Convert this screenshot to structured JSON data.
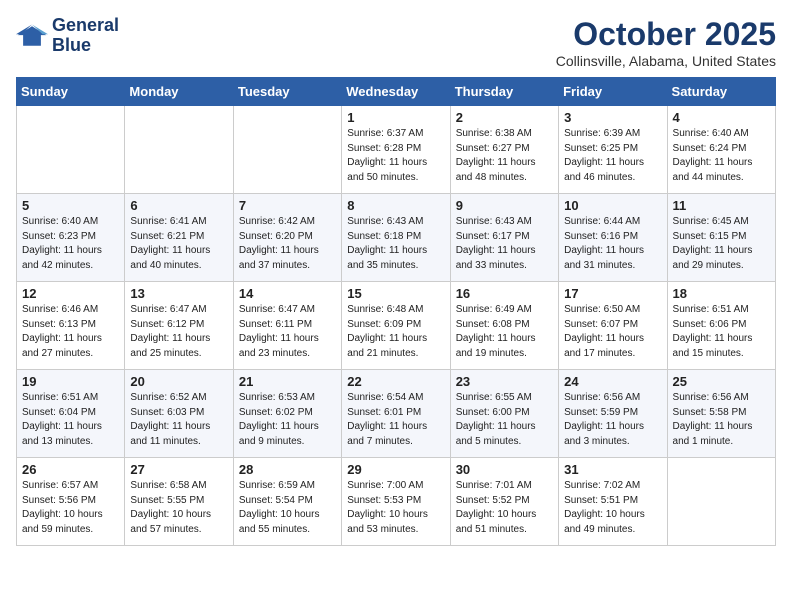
{
  "header": {
    "logo_line1": "General",
    "logo_line2": "Blue",
    "month": "October 2025",
    "location": "Collinsville, Alabama, United States"
  },
  "weekdays": [
    "Sunday",
    "Monday",
    "Tuesday",
    "Wednesday",
    "Thursday",
    "Friday",
    "Saturday"
  ],
  "weeks": [
    [
      {
        "day": "",
        "info": ""
      },
      {
        "day": "",
        "info": ""
      },
      {
        "day": "",
        "info": ""
      },
      {
        "day": "1",
        "info": "Sunrise: 6:37 AM\nSunset: 6:28 PM\nDaylight: 11 hours\nand 50 minutes."
      },
      {
        "day": "2",
        "info": "Sunrise: 6:38 AM\nSunset: 6:27 PM\nDaylight: 11 hours\nand 48 minutes."
      },
      {
        "day": "3",
        "info": "Sunrise: 6:39 AM\nSunset: 6:25 PM\nDaylight: 11 hours\nand 46 minutes."
      },
      {
        "day": "4",
        "info": "Sunrise: 6:40 AM\nSunset: 6:24 PM\nDaylight: 11 hours\nand 44 minutes."
      }
    ],
    [
      {
        "day": "5",
        "info": "Sunrise: 6:40 AM\nSunset: 6:23 PM\nDaylight: 11 hours\nand 42 minutes."
      },
      {
        "day": "6",
        "info": "Sunrise: 6:41 AM\nSunset: 6:21 PM\nDaylight: 11 hours\nand 40 minutes."
      },
      {
        "day": "7",
        "info": "Sunrise: 6:42 AM\nSunset: 6:20 PM\nDaylight: 11 hours\nand 37 minutes."
      },
      {
        "day": "8",
        "info": "Sunrise: 6:43 AM\nSunset: 6:18 PM\nDaylight: 11 hours\nand 35 minutes."
      },
      {
        "day": "9",
        "info": "Sunrise: 6:43 AM\nSunset: 6:17 PM\nDaylight: 11 hours\nand 33 minutes."
      },
      {
        "day": "10",
        "info": "Sunrise: 6:44 AM\nSunset: 6:16 PM\nDaylight: 11 hours\nand 31 minutes."
      },
      {
        "day": "11",
        "info": "Sunrise: 6:45 AM\nSunset: 6:15 PM\nDaylight: 11 hours\nand 29 minutes."
      }
    ],
    [
      {
        "day": "12",
        "info": "Sunrise: 6:46 AM\nSunset: 6:13 PM\nDaylight: 11 hours\nand 27 minutes."
      },
      {
        "day": "13",
        "info": "Sunrise: 6:47 AM\nSunset: 6:12 PM\nDaylight: 11 hours\nand 25 minutes."
      },
      {
        "day": "14",
        "info": "Sunrise: 6:47 AM\nSunset: 6:11 PM\nDaylight: 11 hours\nand 23 minutes."
      },
      {
        "day": "15",
        "info": "Sunrise: 6:48 AM\nSunset: 6:09 PM\nDaylight: 11 hours\nand 21 minutes."
      },
      {
        "day": "16",
        "info": "Sunrise: 6:49 AM\nSunset: 6:08 PM\nDaylight: 11 hours\nand 19 minutes."
      },
      {
        "day": "17",
        "info": "Sunrise: 6:50 AM\nSunset: 6:07 PM\nDaylight: 11 hours\nand 17 minutes."
      },
      {
        "day": "18",
        "info": "Sunrise: 6:51 AM\nSunset: 6:06 PM\nDaylight: 11 hours\nand 15 minutes."
      }
    ],
    [
      {
        "day": "19",
        "info": "Sunrise: 6:51 AM\nSunset: 6:04 PM\nDaylight: 11 hours\nand 13 minutes."
      },
      {
        "day": "20",
        "info": "Sunrise: 6:52 AM\nSunset: 6:03 PM\nDaylight: 11 hours\nand 11 minutes."
      },
      {
        "day": "21",
        "info": "Sunrise: 6:53 AM\nSunset: 6:02 PM\nDaylight: 11 hours\nand 9 minutes."
      },
      {
        "day": "22",
        "info": "Sunrise: 6:54 AM\nSunset: 6:01 PM\nDaylight: 11 hours\nand 7 minutes."
      },
      {
        "day": "23",
        "info": "Sunrise: 6:55 AM\nSunset: 6:00 PM\nDaylight: 11 hours\nand 5 minutes."
      },
      {
        "day": "24",
        "info": "Sunrise: 6:56 AM\nSunset: 5:59 PM\nDaylight: 11 hours\nand 3 minutes."
      },
      {
        "day": "25",
        "info": "Sunrise: 6:56 AM\nSunset: 5:58 PM\nDaylight: 11 hours\nand 1 minute."
      }
    ],
    [
      {
        "day": "26",
        "info": "Sunrise: 6:57 AM\nSunset: 5:56 PM\nDaylight: 10 hours\nand 59 minutes."
      },
      {
        "day": "27",
        "info": "Sunrise: 6:58 AM\nSunset: 5:55 PM\nDaylight: 10 hours\nand 57 minutes."
      },
      {
        "day": "28",
        "info": "Sunrise: 6:59 AM\nSunset: 5:54 PM\nDaylight: 10 hours\nand 55 minutes."
      },
      {
        "day": "29",
        "info": "Sunrise: 7:00 AM\nSunset: 5:53 PM\nDaylight: 10 hours\nand 53 minutes."
      },
      {
        "day": "30",
        "info": "Sunrise: 7:01 AM\nSunset: 5:52 PM\nDaylight: 10 hours\nand 51 minutes."
      },
      {
        "day": "31",
        "info": "Sunrise: 7:02 AM\nSunset: 5:51 PM\nDaylight: 10 hours\nand 49 minutes."
      },
      {
        "day": "",
        "info": ""
      }
    ]
  ]
}
